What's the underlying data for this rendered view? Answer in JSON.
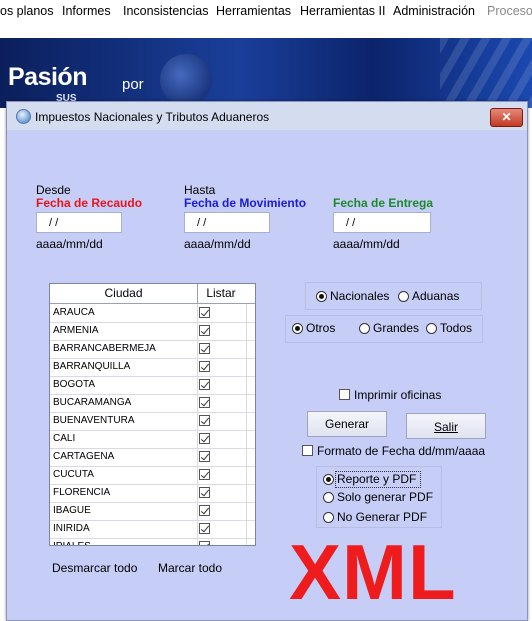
{
  "menubar": {
    "items": [
      "os planos",
      "Informes",
      "Inconsistencias",
      "Herramientas",
      "Herramientas II",
      "Administración",
      "Procesos"
    ]
  },
  "banner": {
    "title": "Pasión",
    "sub": "por",
    "sub2": "SUS"
  },
  "dialog": {
    "title": "Impuestos Nacionales y Tributos Aduaneros",
    "close_label": "✕"
  },
  "dates": {
    "desde": "Desde",
    "hasta": "Hasta",
    "recaudo_label": "Fecha de Recaudo",
    "movimiento_label": "Fecha de Movimiento",
    "entrega_label": "Fecha de Entrega",
    "recaudo_value": "/ /",
    "movimiento_value": "/ /",
    "entrega_value": "/ /",
    "format_hint": "aaaa/mm/dd",
    "colors": {
      "recaudo": "#e8141d",
      "movimiento": "#1b1bd8",
      "entrega": "#1c8a2b"
    }
  },
  "cities": {
    "col_city": "Ciudad",
    "col_list": "Listar",
    "rows": [
      {
        "name": "ARAUCA",
        "checked": true
      },
      {
        "name": "ARMENIA",
        "checked": true
      },
      {
        "name": "BARRANCABERMEJA",
        "checked": true
      },
      {
        "name": "BARRANQUILLA",
        "checked": true
      },
      {
        "name": "BOGOTA",
        "checked": true
      },
      {
        "name": "BUCARAMANGA",
        "checked": true
      },
      {
        "name": "BUENAVENTURA",
        "checked": true
      },
      {
        "name": "CALI",
        "checked": true
      },
      {
        "name": "CARTAGENA",
        "checked": true
      },
      {
        "name": "CUCUTA",
        "checked": true
      },
      {
        "name": "FLORENCIA",
        "checked": true
      },
      {
        "name": "IBAGUE",
        "checked": true
      },
      {
        "name": "INIRIDA",
        "checked": true
      },
      {
        "name": "IPIALES",
        "checked": true
      }
    ],
    "unmark_all": "Desmarcar todo",
    "mark_all": "Marcar todo"
  },
  "options": {
    "nacionales": "Nacionales",
    "aduanas": "Aduanas",
    "otros": "Otros",
    "grandes": "Grandes",
    "todos": "Todos",
    "imprimir_oficinas": "Imprimir oficinas",
    "generar": "Generar",
    "salir": "Salir",
    "formato_fecha": "Formato de Fecha dd/mm/aaaa",
    "reporte_pdf": "Reporte y PDF",
    "solo_pdf": "Solo generar PDF",
    "no_pdf": "No Generar PDF"
  },
  "overlay_text": "XML",
  "colors": {
    "dialog_bg": "#c6cdf6",
    "overlay": "#ee1c1c"
  }
}
